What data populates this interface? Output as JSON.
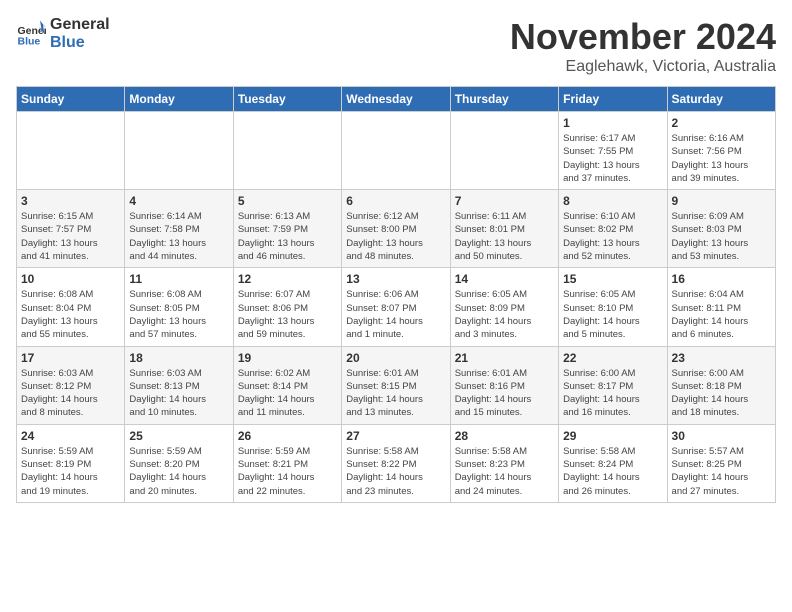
{
  "header": {
    "logo_general": "General",
    "logo_blue": "Blue",
    "month": "November 2024",
    "location": "Eaglehawk, Victoria, Australia"
  },
  "weekdays": [
    "Sunday",
    "Monday",
    "Tuesday",
    "Wednesday",
    "Thursday",
    "Friday",
    "Saturday"
  ],
  "weeks": [
    [
      {
        "day": "",
        "info": ""
      },
      {
        "day": "",
        "info": ""
      },
      {
        "day": "",
        "info": ""
      },
      {
        "day": "",
        "info": ""
      },
      {
        "day": "",
        "info": ""
      },
      {
        "day": "1",
        "info": "Sunrise: 6:17 AM\nSunset: 7:55 PM\nDaylight: 13 hours\nand 37 minutes."
      },
      {
        "day": "2",
        "info": "Sunrise: 6:16 AM\nSunset: 7:56 PM\nDaylight: 13 hours\nand 39 minutes."
      }
    ],
    [
      {
        "day": "3",
        "info": "Sunrise: 6:15 AM\nSunset: 7:57 PM\nDaylight: 13 hours\nand 41 minutes."
      },
      {
        "day": "4",
        "info": "Sunrise: 6:14 AM\nSunset: 7:58 PM\nDaylight: 13 hours\nand 44 minutes."
      },
      {
        "day": "5",
        "info": "Sunrise: 6:13 AM\nSunset: 7:59 PM\nDaylight: 13 hours\nand 46 minutes."
      },
      {
        "day": "6",
        "info": "Sunrise: 6:12 AM\nSunset: 8:00 PM\nDaylight: 13 hours\nand 48 minutes."
      },
      {
        "day": "7",
        "info": "Sunrise: 6:11 AM\nSunset: 8:01 PM\nDaylight: 13 hours\nand 50 minutes."
      },
      {
        "day": "8",
        "info": "Sunrise: 6:10 AM\nSunset: 8:02 PM\nDaylight: 13 hours\nand 52 minutes."
      },
      {
        "day": "9",
        "info": "Sunrise: 6:09 AM\nSunset: 8:03 PM\nDaylight: 13 hours\nand 53 minutes."
      }
    ],
    [
      {
        "day": "10",
        "info": "Sunrise: 6:08 AM\nSunset: 8:04 PM\nDaylight: 13 hours\nand 55 minutes."
      },
      {
        "day": "11",
        "info": "Sunrise: 6:08 AM\nSunset: 8:05 PM\nDaylight: 13 hours\nand 57 minutes."
      },
      {
        "day": "12",
        "info": "Sunrise: 6:07 AM\nSunset: 8:06 PM\nDaylight: 13 hours\nand 59 minutes."
      },
      {
        "day": "13",
        "info": "Sunrise: 6:06 AM\nSunset: 8:07 PM\nDaylight: 14 hours\nand 1 minute."
      },
      {
        "day": "14",
        "info": "Sunrise: 6:05 AM\nSunset: 8:09 PM\nDaylight: 14 hours\nand 3 minutes."
      },
      {
        "day": "15",
        "info": "Sunrise: 6:05 AM\nSunset: 8:10 PM\nDaylight: 14 hours\nand 5 minutes."
      },
      {
        "day": "16",
        "info": "Sunrise: 6:04 AM\nSunset: 8:11 PM\nDaylight: 14 hours\nand 6 minutes."
      }
    ],
    [
      {
        "day": "17",
        "info": "Sunrise: 6:03 AM\nSunset: 8:12 PM\nDaylight: 14 hours\nand 8 minutes."
      },
      {
        "day": "18",
        "info": "Sunrise: 6:03 AM\nSunset: 8:13 PM\nDaylight: 14 hours\nand 10 minutes."
      },
      {
        "day": "19",
        "info": "Sunrise: 6:02 AM\nSunset: 8:14 PM\nDaylight: 14 hours\nand 11 minutes."
      },
      {
        "day": "20",
        "info": "Sunrise: 6:01 AM\nSunset: 8:15 PM\nDaylight: 14 hours\nand 13 minutes."
      },
      {
        "day": "21",
        "info": "Sunrise: 6:01 AM\nSunset: 8:16 PM\nDaylight: 14 hours\nand 15 minutes."
      },
      {
        "day": "22",
        "info": "Sunrise: 6:00 AM\nSunset: 8:17 PM\nDaylight: 14 hours\nand 16 minutes."
      },
      {
        "day": "23",
        "info": "Sunrise: 6:00 AM\nSunset: 8:18 PM\nDaylight: 14 hours\nand 18 minutes."
      }
    ],
    [
      {
        "day": "24",
        "info": "Sunrise: 5:59 AM\nSunset: 8:19 PM\nDaylight: 14 hours\nand 19 minutes."
      },
      {
        "day": "25",
        "info": "Sunrise: 5:59 AM\nSunset: 8:20 PM\nDaylight: 14 hours\nand 20 minutes."
      },
      {
        "day": "26",
        "info": "Sunrise: 5:59 AM\nSunset: 8:21 PM\nDaylight: 14 hours\nand 22 minutes."
      },
      {
        "day": "27",
        "info": "Sunrise: 5:58 AM\nSunset: 8:22 PM\nDaylight: 14 hours\nand 23 minutes."
      },
      {
        "day": "28",
        "info": "Sunrise: 5:58 AM\nSunset: 8:23 PM\nDaylight: 14 hours\nand 24 minutes."
      },
      {
        "day": "29",
        "info": "Sunrise: 5:58 AM\nSunset: 8:24 PM\nDaylight: 14 hours\nand 26 minutes."
      },
      {
        "day": "30",
        "info": "Sunrise: 5:57 AM\nSunset: 8:25 PM\nDaylight: 14 hours\nand 27 minutes."
      }
    ]
  ]
}
